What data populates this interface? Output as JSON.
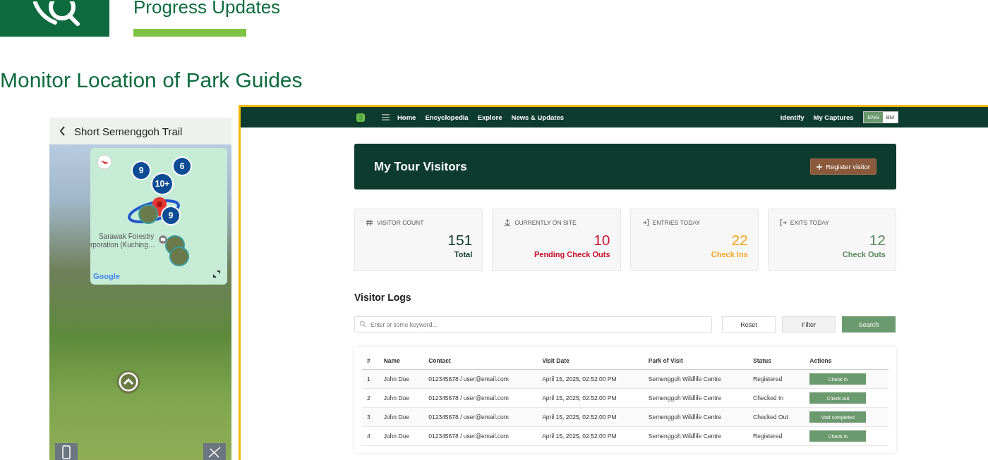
{
  "slide": {
    "title": "Progress Updates",
    "subtitle": "Monitor Location of Park Guides"
  },
  "phone": {
    "title": "Short Semenggoh Trail",
    "map": {
      "clusters": [
        "9",
        "6",
        "10+",
        "9"
      ],
      "place_label_1": "Sarawak Forestry",
      "place_label_2": "rporation (Kuching…",
      "attribution": "Google"
    }
  },
  "web": {
    "nav": {
      "links": [
        "Home",
        "Encyclopedia",
        "Explore",
        "News & Updates"
      ],
      "right_links": [
        "Identify",
        "My Captures"
      ],
      "languages": [
        {
          "label": "ENG",
          "selected": true
        },
        {
          "label": "BM",
          "selected": false
        }
      ]
    },
    "hero": {
      "title": "My Tour Visitors",
      "button": "Register visitor"
    },
    "stats": [
      {
        "kind": "hash",
        "label": "VISITOR COUNT",
        "value": "151",
        "caption": "Total",
        "color": "#0d3b2e"
      },
      {
        "kind": "onsite",
        "label": "CURRENTLY ON SITE",
        "value": "10",
        "caption": "Pending Check Outs",
        "color": "#c8102e"
      },
      {
        "kind": "entry",
        "label": "ENTRIES TODAY",
        "value": "22",
        "caption": "Check Ins",
        "color": "#f5a623"
      },
      {
        "kind": "exit",
        "label": "EXITS TODAY",
        "value": "12",
        "caption": "Check Outs",
        "color": "#5b8a5f"
      }
    ],
    "logs": {
      "title": "Visitor Logs",
      "search_placeholder": "Enter or some keyword...",
      "buttons": [
        "Reset",
        "Filter",
        "Search"
      ],
      "columns": [
        "#",
        "Name",
        "Contact",
        "Visit Date",
        "Park of Visit",
        "Status",
        "Actions"
      ],
      "rows": [
        [
          "1",
          "John Doe",
          "012345678 / user@email.com",
          "April 15, 2025, 02:52:00 PM",
          "Semenggoh Wildlife Centre",
          "Registered",
          "Check in"
        ],
        [
          "2",
          "John Doe",
          "012345678 / user@email.com",
          "April 15, 2025, 02:52:00 PM",
          "Semenggoh Wildlife Centre",
          "Checked In",
          "Check out"
        ],
        [
          "3",
          "John Doe",
          "012345678 / user@email.com",
          "April 15, 2025, 02:52:00 PM",
          "Semenggoh Wildlife Centre",
          "Checked Out",
          "Visit completed"
        ],
        [
          "4",
          "John Doe",
          "012345678 / user@email.com",
          "April 15, 2025, 02:52:00 PM",
          "Semenggoh Wildlife Centre",
          "Registered",
          "Check in"
        ]
      ]
    }
  }
}
